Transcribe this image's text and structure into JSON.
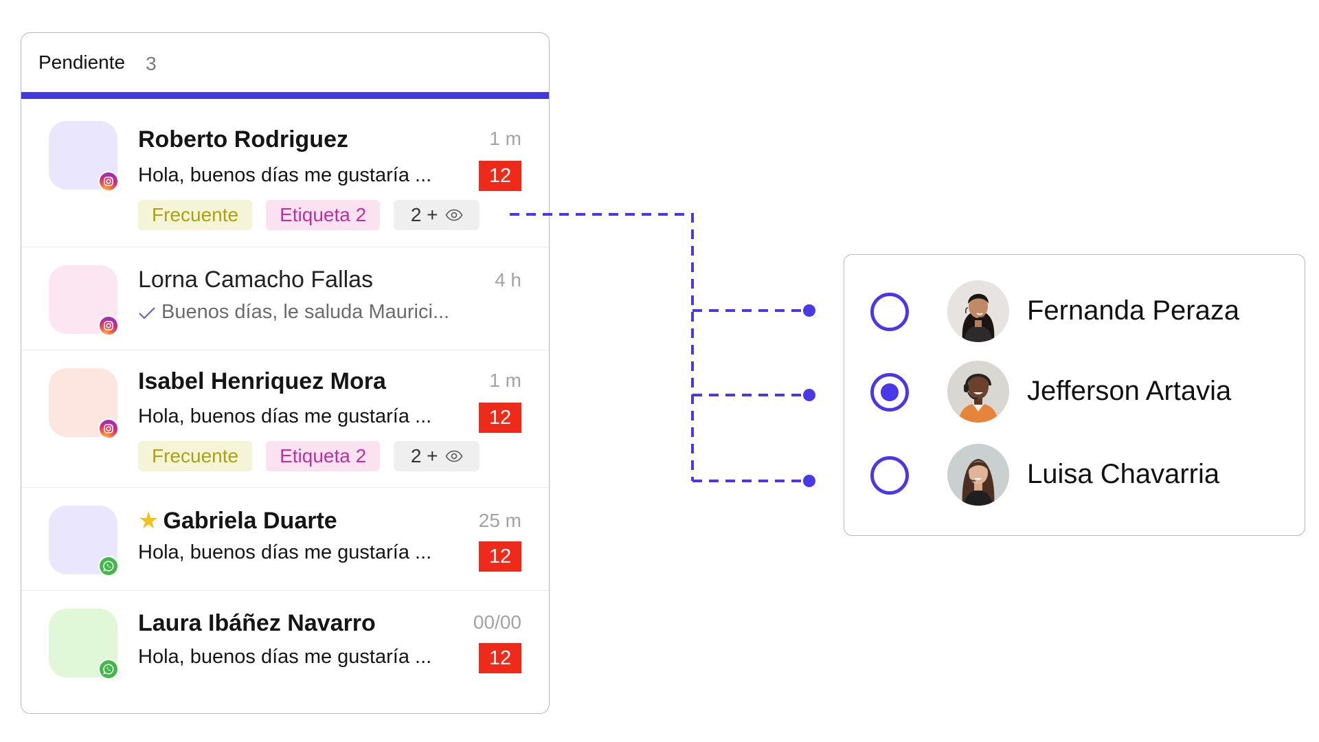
{
  "inbox": {
    "tab_label": "Pendiente",
    "tab_count": "3",
    "conversations": [
      {
        "name": "Roberto Rodriguez",
        "time": "1 m",
        "preview": "Hola, buenos días me gustaría ...",
        "unread": "12",
        "channel": "instagram-icon",
        "avatar_color": "#e9e6fd",
        "tags": [
          "Frecuente",
          "Etiqueta 2"
        ],
        "more_tags": "2 +"
      },
      {
        "name": "Lorna Camacho Fallas",
        "time": "4 h",
        "preview": "Buenos días, le saluda Maurici...",
        "channel": "instagram-icon",
        "avatar_color": "#fce6f1"
      },
      {
        "name": "Isabel Henriquez Mora",
        "time": "1 m",
        "preview": "Hola, buenos días me gustaría ...",
        "unread": "12",
        "channel": "instagram-icon",
        "avatar_color": "#fde6df",
        "tags": [
          "Frecuente",
          "Etiqueta 2"
        ],
        "more_tags": "2 +"
      },
      {
        "name": "Gabriela Duarte",
        "starred": true,
        "time": "25 m",
        "preview": "Hola, buenos días me gustaría ...",
        "unread": "12",
        "channel": "whatsapp-icon",
        "avatar_color": "#e9e6fd"
      },
      {
        "name": "Laura Ibáñez Navarro",
        "time": "00/00",
        "preview": "Hola, buenos días me gustaría ...",
        "unread": "12",
        "channel": "whatsapp-icon",
        "avatar_color": "#e0f8d8"
      }
    ]
  },
  "agents": [
    {
      "name": "Fernanda Peraza",
      "selected": false
    },
    {
      "name": "Jefferson Artavia",
      "selected": true
    },
    {
      "name": "Luisa Chavarria",
      "selected": false
    }
  ],
  "colors": {
    "accent": "#4338d9",
    "radio": "#4a37e8",
    "unread_badge": "#ee2a1a",
    "tag_frecuente_bg": "#f5f4d7",
    "tag_etiqueta_bg": "#fbe2f0",
    "connector": "#4a37e8"
  }
}
